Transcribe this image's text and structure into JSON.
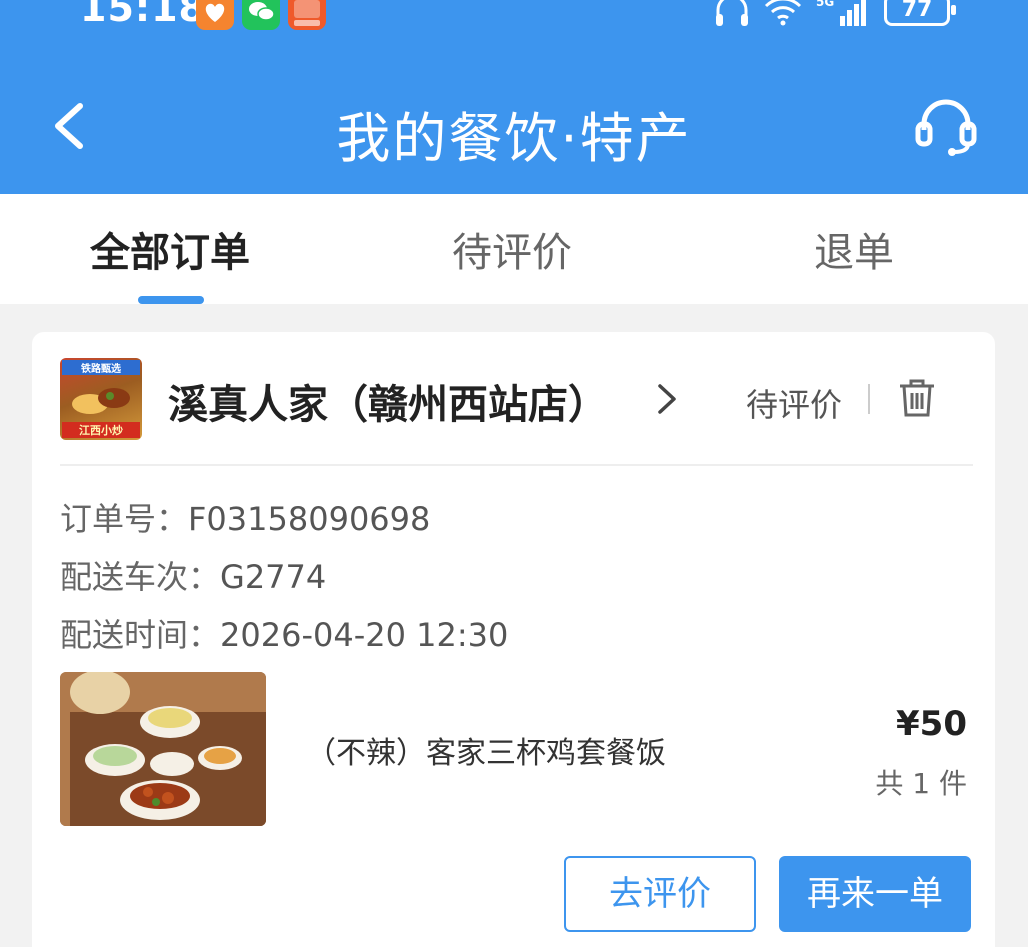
{
  "status_bar": {
    "time": "15:18",
    "battery": "77",
    "network": "5G"
  },
  "header": {
    "title": "我的餐饮·特产",
    "back_icon": "chevron-left-icon",
    "support_icon": "headset-icon",
    "bg_color": "#3d95ee"
  },
  "tabs": [
    {
      "label": "全部订单",
      "active": true
    },
    {
      "label": "待评价",
      "active": false
    },
    {
      "label": "退单",
      "active": false
    }
  ],
  "order": {
    "shop_name": "溪真人家（赣州西站店）",
    "shop_logo_text_top": "铁路甄选",
    "shop_logo_text_bottom": "江西小炒",
    "status": "待评价",
    "order_no_label": "订单号：",
    "order_no": "F03158090698",
    "train_label": "配送车次：",
    "train": "G2774",
    "time_label": "配送时间：",
    "time": "2026-04-20 12:30",
    "item": {
      "name": "（不辣）客家三杯鸡套餐饭",
      "price": "¥50",
      "quantity": "共 1 件"
    },
    "buttons": {
      "review": "去评价",
      "reorder": "再来一单"
    }
  }
}
